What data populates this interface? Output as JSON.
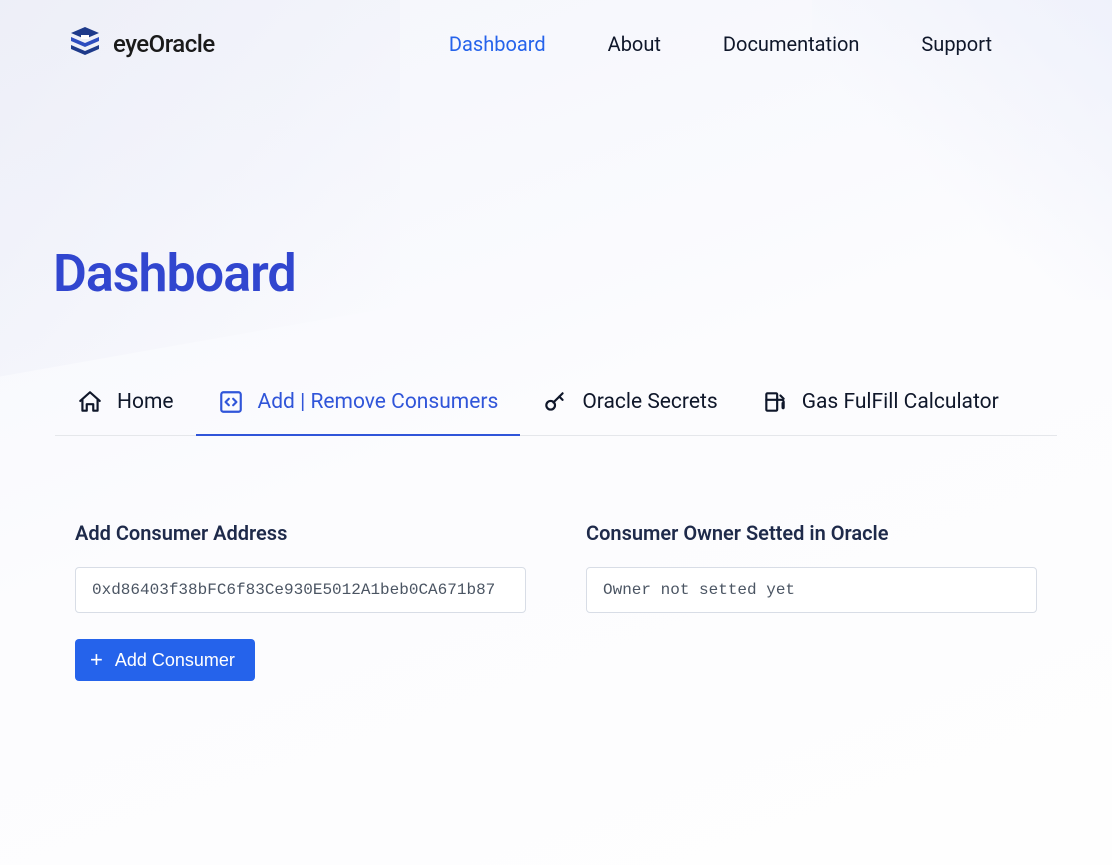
{
  "header": {
    "brand": "eyeOracle",
    "nav": [
      {
        "label": "Dashboard",
        "active": true
      },
      {
        "label": "About",
        "active": false
      },
      {
        "label": "Documentation",
        "active": false
      },
      {
        "label": "Support",
        "active": false
      }
    ]
  },
  "page": {
    "title": "Dashboard"
  },
  "tabs": [
    {
      "label": "Home",
      "icon": "home-icon",
      "active": false
    },
    {
      "label": "Add | Remove Consumers",
      "icon": "code-box-icon",
      "active": true
    },
    {
      "label": "Oracle Secrets",
      "icon": "key-icon",
      "active": false
    },
    {
      "label": "Gas FulFill Calculator",
      "icon": "gas-pump-icon",
      "active": false
    }
  ],
  "form": {
    "add_label": "Add Consumer Address",
    "address_value": "0xd86403f38bFC6f83Ce930E5012A1beb0CA671b87",
    "owner_label": "Consumer Owner Setted in Oracle",
    "owner_value": "Owner not setted yet",
    "add_button_label": "Add Consumer"
  },
  "colors": {
    "accent": "#2563eb",
    "title": "#3146cf"
  }
}
